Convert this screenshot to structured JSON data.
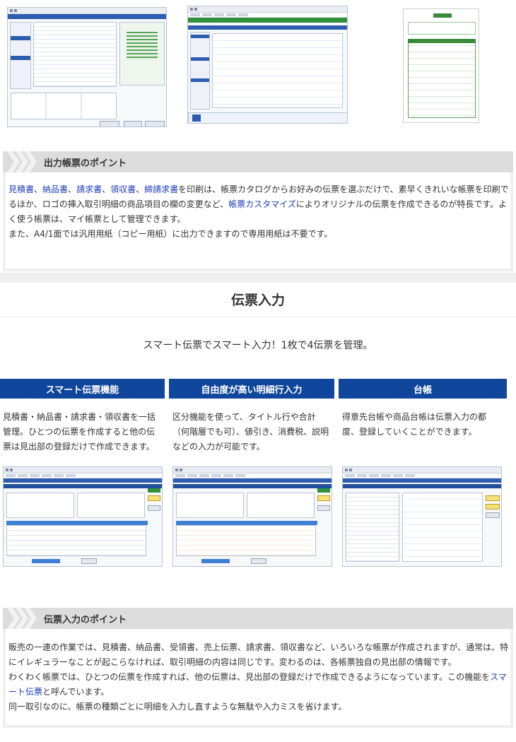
{
  "top_section": {
    "point_title": "出力帳票のポイント",
    "links": {
      "l1": "見積書",
      "l2": "納品書",
      "l3": "請求書",
      "l4": "領収書",
      "l5": "締請求書",
      "l6": "帳票カスタマイズ"
    },
    "text": {
      "sep": "、",
      "t1": "を印刷は、帳票カタログからお好みの伝票を選ぶだけで、素早くきれいな帳票を印刷でるほか、ロゴの挿入取引明細の商品項目の欄の変更など、",
      "t2": "によりオリジナルの伝票を作成できるのが特長です。よく使う帳票は、マイ帳票として管理できます。",
      "p2": "また、A4/1面では汎用用紙（コピー用紙）に出力できますので専用用紙は不要です。"
    }
  },
  "section": {
    "title": "伝票入力",
    "subtitle": "スマート伝票でスマート入力！1枚で4伝票を管理。"
  },
  "features": [
    {
      "title": "スマート伝票機能",
      "description": "見積書・納品書・請求書・領収書を一括管理。ひとつの伝票を作成すると他の伝票は見出部の登録だけで作成できます。"
    },
    {
      "title": "自由度が高い明細行入力",
      "description": "区分機能を使って、タイトル行や合計（何階層でも可）、値引き、消費税、説明などの入力が可能です。"
    },
    {
      "title": "台帳",
      "description": "得意先台帳や商品台帳は伝票入力の都度、登録していくことができます。"
    }
  ],
  "bottom_section": {
    "point_title": "伝票入力のポイント",
    "p1": "販売の一連の作業では、見積書、納品書、受領書、売上伝票、請求書、領収書など、いろいろな帳票が作成されますが、通常は、特にイレギュラーなことが起こらなければ、取引明細の内容は同じです。変わるのは、各帳票独自の見出部の情報です。",
    "p2a": "わくわく帳票では、ひとつの伝票を作成すれば、他の伝票は、見出部の登録だけで作成できるようになっています。この機能を",
    "p2_link": "スマート伝票",
    "p2b": "と呼んでいます。",
    "p3": "同一取引なのに、帳票の種類ごとに明細を入力し直すような無駄や入力ミスを省けます。"
  },
  "colors": {
    "feature_header": "#10469b",
    "link": "#1c3cb8",
    "point_header_bg": "#dcdcdc"
  }
}
